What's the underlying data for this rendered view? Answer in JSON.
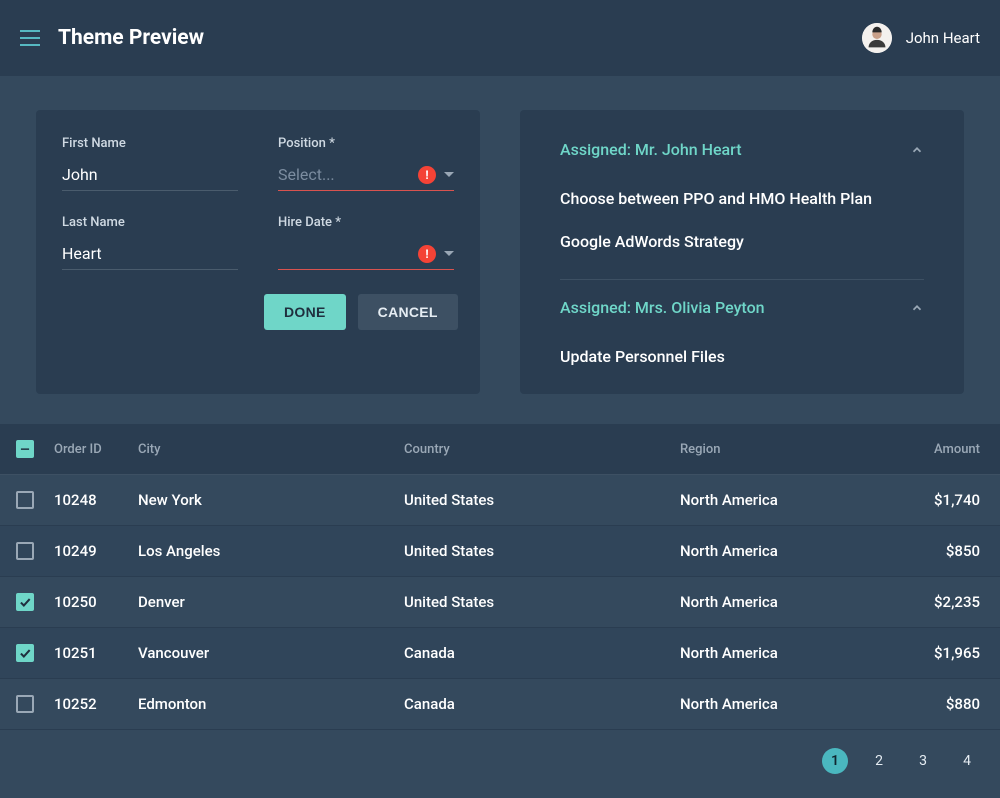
{
  "header": {
    "title": "Theme Preview",
    "user_name": "John Heart"
  },
  "form": {
    "first_name_label": "First Name",
    "first_name_value": "John",
    "last_name_label": "Last Name",
    "last_name_value": "Heart",
    "position_label": "Position *",
    "position_placeholder": "Select...",
    "hire_date_label": "Hire Date *",
    "hire_date_placeholder": "",
    "done_label": "DONE",
    "cancel_label": "CANCEL",
    "error_glyph": "!"
  },
  "accordion": {
    "sections": [
      {
        "title": "Assigned: Mr. John Heart",
        "items": [
          "Choose between PPO and HMO Health Plan",
          "Google AdWords Strategy"
        ]
      },
      {
        "title": "Assigned: Mrs. Olivia Peyton",
        "items": [
          "Update Personnel Files"
        ]
      }
    ]
  },
  "table": {
    "headers": {
      "order_id": "Order ID",
      "city": "City",
      "country": "Country",
      "region": "Region",
      "amount": "Amount"
    },
    "rows": [
      {
        "checked": false,
        "order_id": "10248",
        "city": "New York",
        "country": "United States",
        "region": "North America",
        "amount": "$1,740"
      },
      {
        "checked": false,
        "order_id": "10249",
        "city": "Los Angeles",
        "country": "United States",
        "region": "North America",
        "amount": "$850"
      },
      {
        "checked": true,
        "order_id": "10250",
        "city": "Denver",
        "country": "United States",
        "region": "North America",
        "amount": "$2,235"
      },
      {
        "checked": true,
        "order_id": "10251",
        "city": "Vancouver",
        "country": "Canada",
        "region": "North America",
        "amount": "$1,965"
      },
      {
        "checked": false,
        "order_id": "10252",
        "city": "Edmonton",
        "country": "Canada",
        "region": "North America",
        "amount": "$880"
      }
    ]
  },
  "pagination": {
    "pages": [
      "1",
      "2",
      "3",
      "4"
    ],
    "active": "1"
  }
}
